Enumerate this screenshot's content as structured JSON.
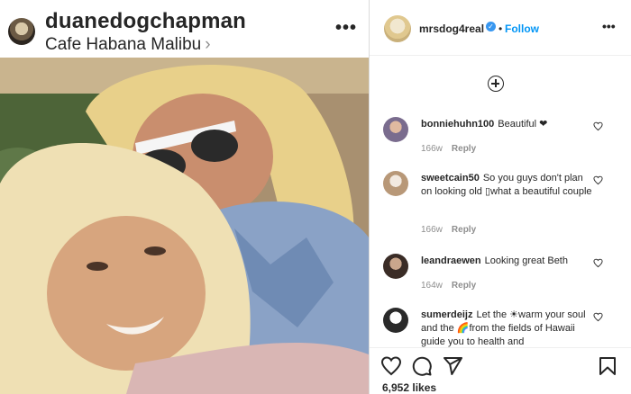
{
  "left_post": {
    "username": "duanedogchapman",
    "location": "Cafe Habana Malibu",
    "location_chevron": "›",
    "more": "•••",
    "photo_icon": "photo-selfie"
  },
  "corner_heart_icon": "heart-icon",
  "right_post": {
    "username": "mrsdog4real",
    "verified_icon": "verified-badge-icon",
    "separator": "•",
    "follow_label": "Follow",
    "more": "•••",
    "add_icon": "plus-circle-icon",
    "comments": [
      {
        "user": "bonniehuhn100",
        "text": "Beautiful ❤",
        "age": "166w",
        "reply": "Reply"
      },
      {
        "user": "sweetcain50",
        "text": "So you guys don't plan on looking old ▯what a beautiful couple",
        "age": "166w",
        "reply": "Reply"
      },
      {
        "user": "leandraewen",
        "text": "Looking great Beth",
        "age": "164w",
        "reply": "Reply"
      },
      {
        "user": "sumerdeijz",
        "text": "Let the ☀warm your soul and the 🌈from the fields of Hawaii guide you to health and",
        "age": "",
        "reply": ""
      }
    ],
    "likes": "6,952 likes"
  },
  "colors": {
    "link_blue": "#0095f6",
    "text": "#262626",
    "meta_gray": "#8e8e8e",
    "border": "#dbdbdb",
    "heart_red": "#ed4956"
  }
}
